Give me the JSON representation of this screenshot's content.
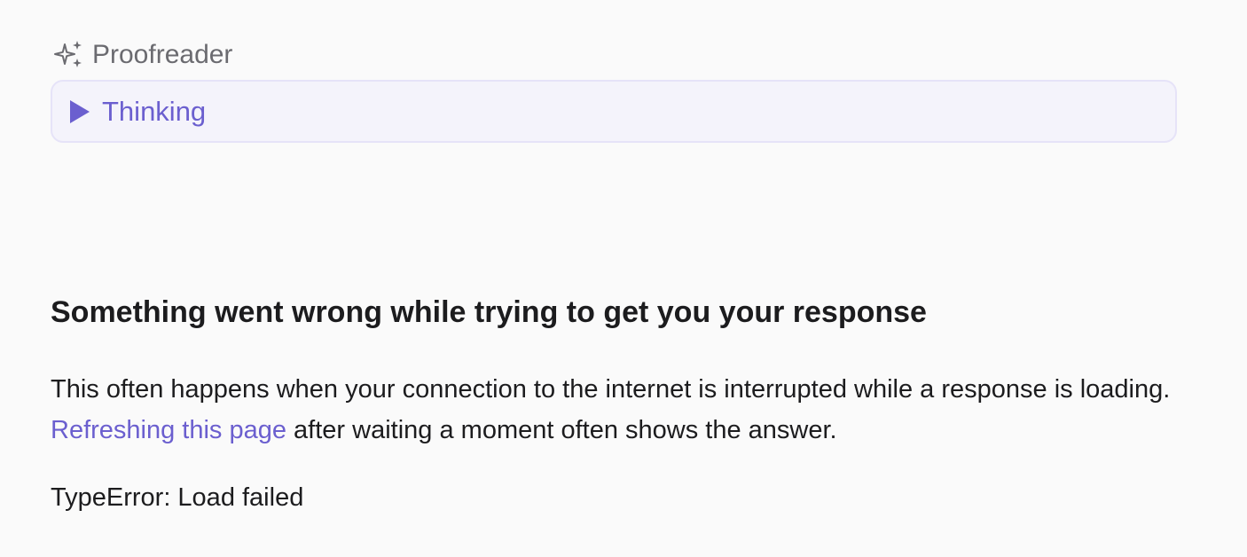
{
  "agent": {
    "name": "Proofreader",
    "icon": "sparkles-icon"
  },
  "thinking": {
    "label": "Thinking",
    "icon": "play-triangle-icon",
    "accent_color": "#6b5fcf"
  },
  "error": {
    "title": "Something went wrong while trying to get you your response",
    "body_before_link": "This often happens when your connection to the internet is interrupted while a response is loading. ",
    "link_text": "Refreshing this page",
    "body_after_link": " after waiting a moment often shows the answer.",
    "detail": "TypeError: Load failed"
  }
}
